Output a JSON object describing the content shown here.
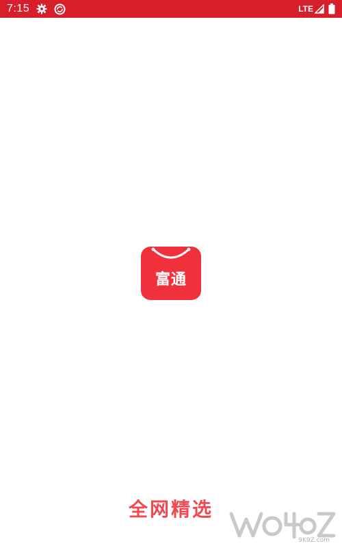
{
  "status_bar": {
    "time": "7:15",
    "network": "LTE",
    "left_icons": [
      "gear-icon",
      "sync-icon"
    ],
    "right_icons": [
      "signal-icon",
      "battery-icon"
    ],
    "background": "#d71f2b"
  },
  "splash": {
    "app_icon": {
      "label": "富通",
      "color": "#f0313b"
    },
    "slogan": "全网精选",
    "slogan_color": "#ef4a52"
  },
  "watermark": {
    "text": "9K9Z.com"
  }
}
